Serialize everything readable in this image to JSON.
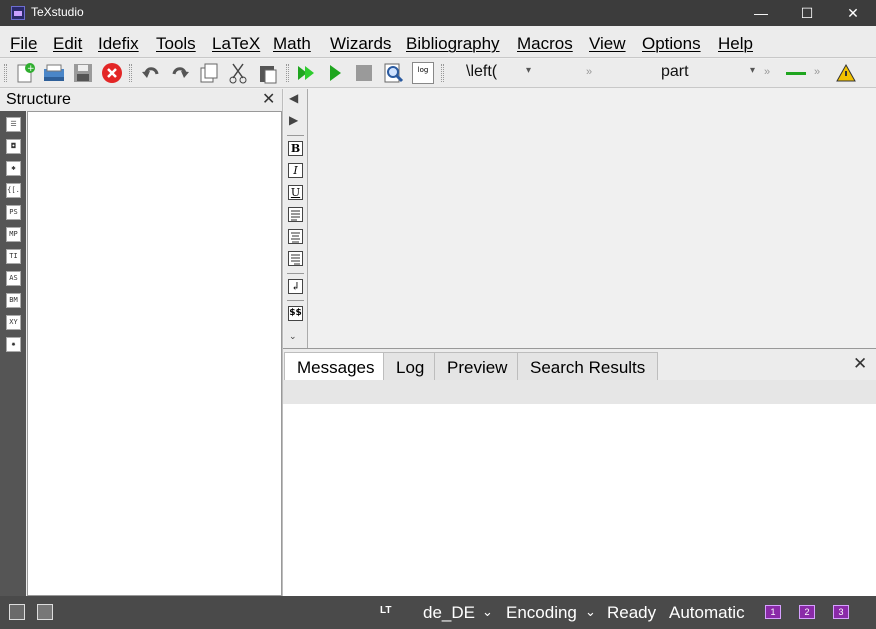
{
  "window": {
    "title": "TeXstudio",
    "min_glyph": "—",
    "max_glyph": "☐",
    "close_glyph": "✕"
  },
  "menu": [
    "File",
    "Edit",
    "Idefix",
    "Tools",
    "LaTeX",
    "Math",
    "Wizards",
    "Bibliography",
    "Macros",
    "View",
    "Options",
    "Help"
  ],
  "toolbar": {
    "icons": [
      "new-file-icon",
      "open-file-icon",
      "save-icon",
      "close-document-icon",
      "undo-icon",
      "redo-icon",
      "copy-icon",
      "cut-icon",
      "paste-icon",
      "build-view-icon",
      "compile-icon",
      "stop-icon",
      "view-icon",
      "log-icon"
    ],
    "log_icon_text": "log",
    "combo_left": "\\left(",
    "combo_right": "part",
    "chevron": "»",
    "combo_arrow": "▾"
  },
  "structure": {
    "title": "Structure",
    "close_glyph": "✕",
    "side_icons": [
      "☰",
      "◘",
      "✱",
      "{[.",
      "PS",
      "MP",
      "TI",
      "AS",
      "BM",
      "XY",
      "✹"
    ]
  },
  "editor_tools": {
    "bold": "B",
    "italic": "I",
    "underline": "U",
    "newline": "↲",
    "math": "$$"
  },
  "bottom_panel": {
    "tabs": [
      "Messages",
      "Log",
      "Preview",
      "Search Results"
    ],
    "active_tab": "Messages",
    "close_glyph": "✕"
  },
  "status": {
    "lt_label": "LT",
    "language": "de_DE",
    "encoding": "Encoding",
    "state": "Ready",
    "mode": "Automatic",
    "dropdown_glyph": "⌄",
    "bookmarks": [
      "1",
      "2",
      "3"
    ]
  }
}
